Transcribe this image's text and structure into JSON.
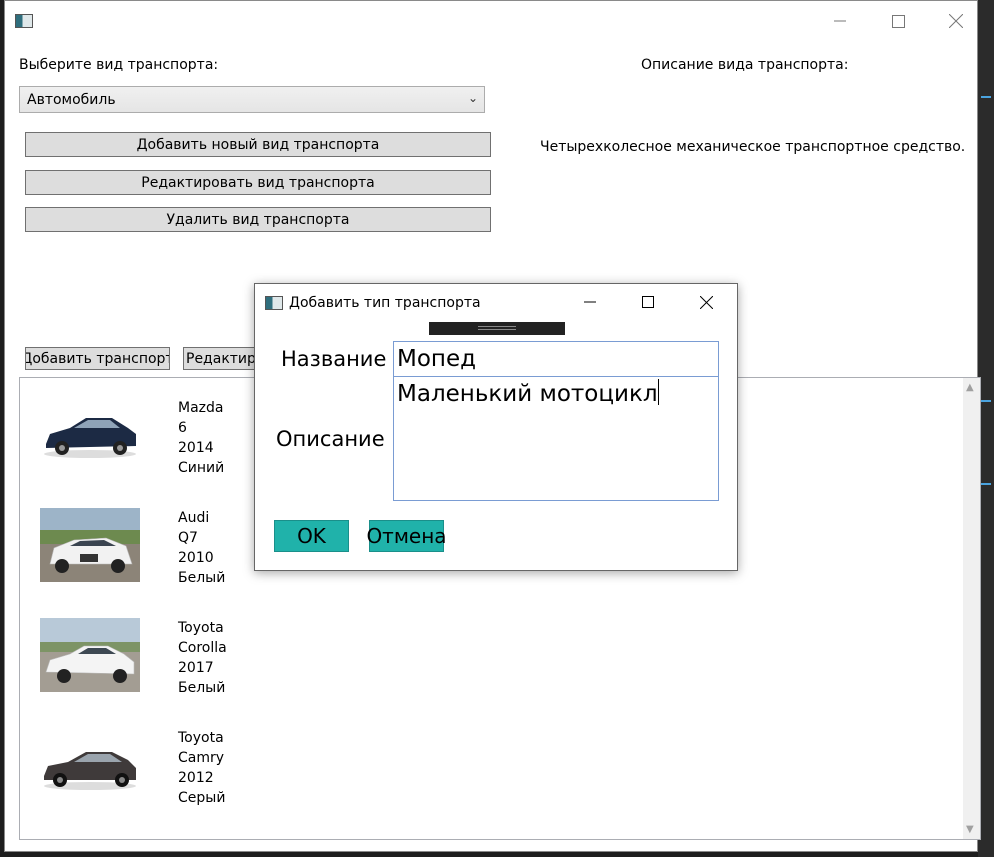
{
  "main": {
    "select_label": "Выберите вид транспорта:",
    "description_header": "Описание вида транспорта:",
    "selected_type": "Автомобиль",
    "description_text": "Четырехколесное механическое транспортное средство.",
    "buttons": {
      "add_type": "Добавить новый вид транспорта",
      "edit_type": "Редактировать вид транспорта",
      "delete_type": "Удалить вид транспорта",
      "add_transport": "Добавить транспорт",
      "edit_transport": "Редактиро"
    },
    "vehicles": [
      {
        "brand": "Mazda",
        "model": "6",
        "year": "2014",
        "color": "Синий",
        "body_hex": "#1c2a44"
      },
      {
        "brand": "Audi",
        "model": "Q7",
        "year": "2010",
        "color": "Белый",
        "body_hex": "#f2f2f2"
      },
      {
        "brand": "Toyota",
        "model": "Corolla",
        "year": "2017",
        "color": "Белый",
        "body_hex": "#f4f4f4"
      },
      {
        "brand": "Toyota",
        "model": "Camry",
        "year": "2012",
        "color": "Серый",
        "body_hex": "#3f3a3a"
      }
    ]
  },
  "dialog": {
    "title": "Добавить тип транспорта",
    "name_label": "Название",
    "name_value": "Мопед",
    "desc_label": "Описание",
    "desc_value": "Маленький мотоцикл",
    "ok": "OK",
    "cancel": "Отмена"
  },
  "colors": {
    "accent_teal": "#20b2aa",
    "button_gray": "#dddddd",
    "textbox_border": "#7a9cd3"
  }
}
